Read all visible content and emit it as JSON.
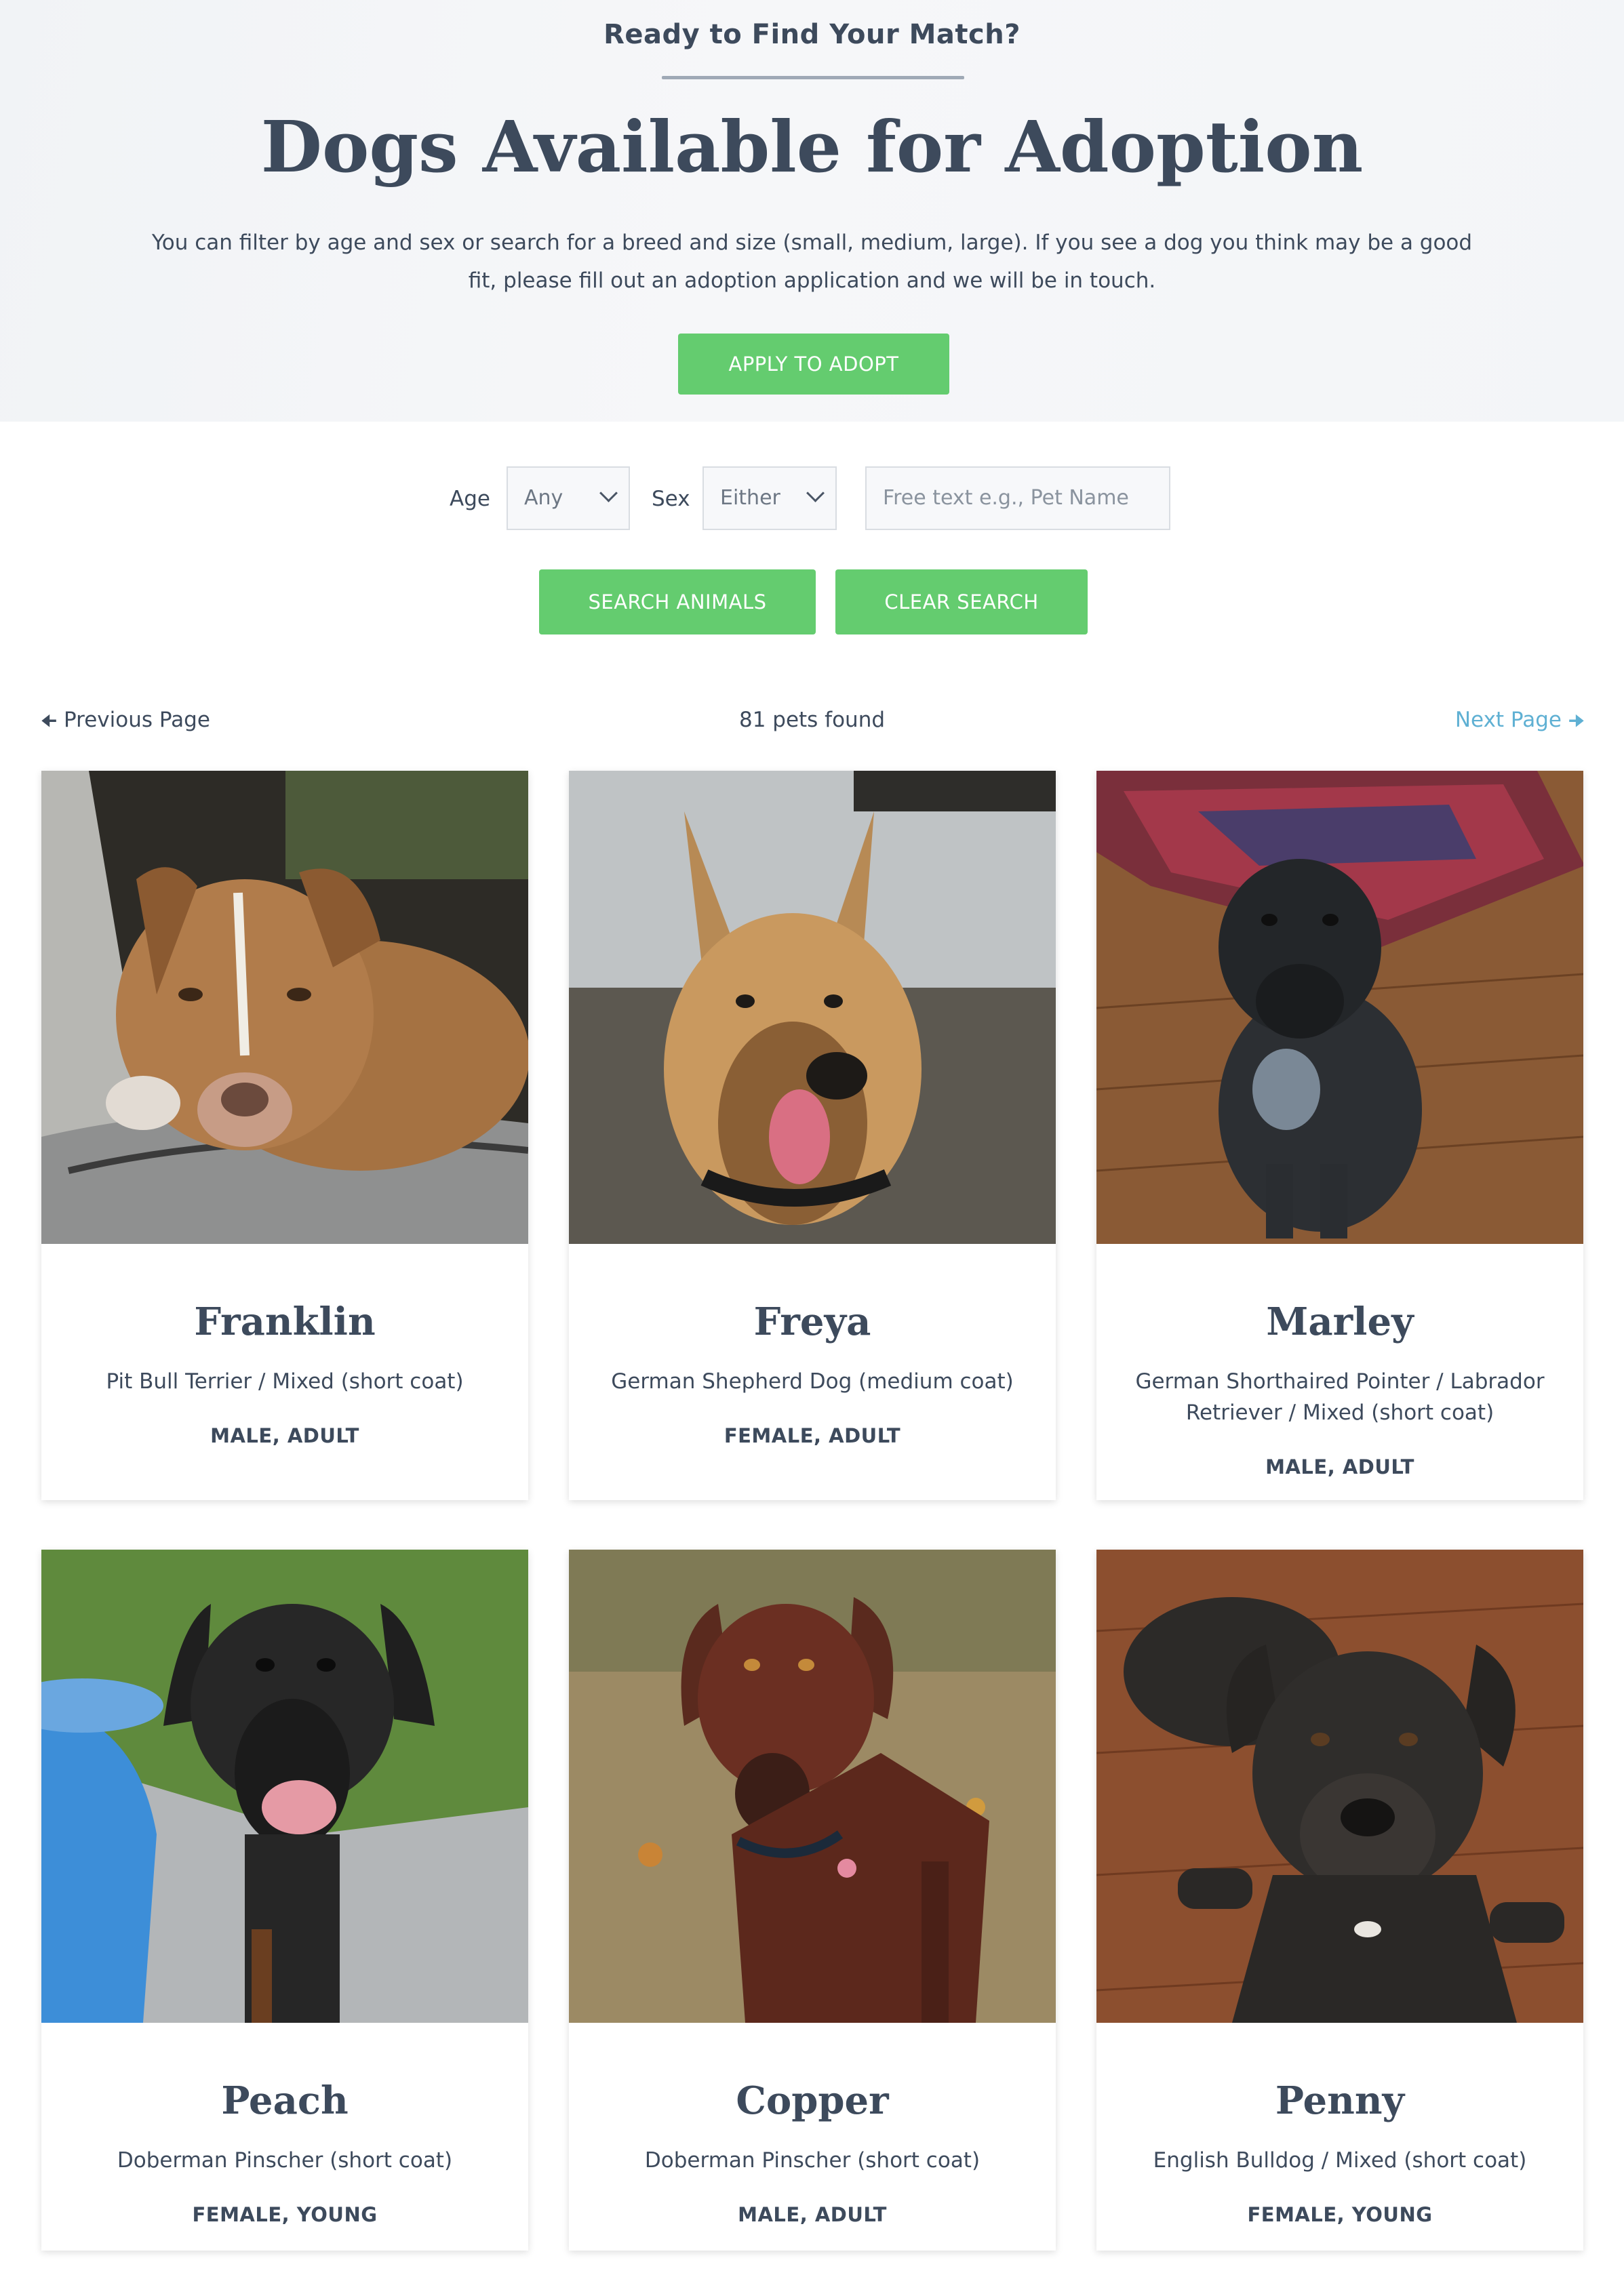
{
  "hero": {
    "eyebrow": "Ready to Find Your Match?",
    "title": "Dogs Available for Adoption",
    "description": "You can filter by age and sex or search for a breed and size (small, medium, large).  If you see a dog you think may be a good fit, please fill out an adoption application and we will be in touch.",
    "apply_label": "APPLY TO ADOPT"
  },
  "filters": {
    "age_label": "Age",
    "age_value": "Any",
    "sex_label": "Sex",
    "sex_value": "Either",
    "search_placeholder": "Free text e.g., Pet Name",
    "search_label": "SEARCH ANIMALS",
    "clear_label": "CLEAR SEARCH"
  },
  "pager": {
    "prev_label": "Previous Page",
    "count": "81 pets found",
    "next_label": "Next Page"
  },
  "pets": [
    {
      "name": "Franklin",
      "breed": "Pit Bull Terrier / Mixed (short coat)",
      "meta": "MALE, ADULT"
    },
    {
      "name": "Freya",
      "breed": "German Shepherd Dog (medium coat)",
      "meta": "FEMALE, ADULT"
    },
    {
      "name": "Marley",
      "breed": "German Shorthaired Pointer / Labrador Retriever / Mixed (short coat)",
      "meta": "MALE, ADULT"
    },
    {
      "name": "Peach",
      "breed": "Doberman Pinscher (short coat)",
      "meta": "FEMALE, YOUNG"
    },
    {
      "name": "Copper",
      "breed": "Doberman Pinscher (short coat)",
      "meta": "MALE, ADULT"
    },
    {
      "name": "Penny",
      "breed": "English Bulldog / Mixed (short coat)",
      "meta": "FEMALE, YOUNG"
    }
  ],
  "colors": {
    "accent_green": "#64cc6f",
    "link_blue": "#5fb0d3",
    "text_dark": "#3d4a5c"
  }
}
